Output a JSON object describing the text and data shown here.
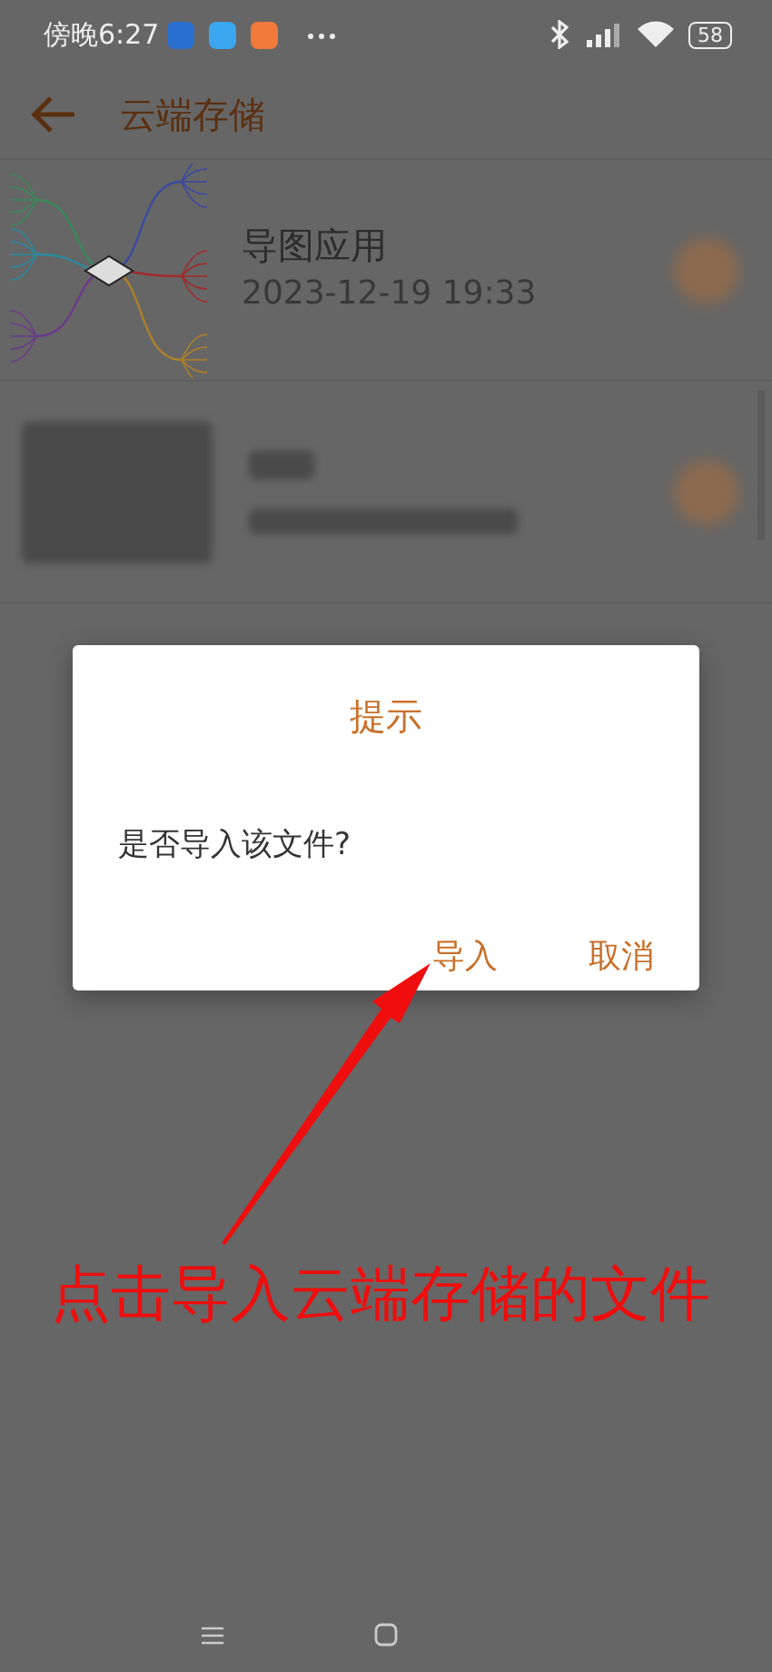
{
  "status_bar": {
    "time": "傍晚6:27",
    "battery": "58"
  },
  "header": {
    "title": "云端存储"
  },
  "files": [
    {
      "kind": "mindmap",
      "name": "导图应用",
      "date": "2023-12-19 19:33"
    },
    {
      "kind": "blurred"
    }
  ],
  "dialog": {
    "title": "提示",
    "message": "是否导入该文件?",
    "buttons": [
      "导入",
      "取消"
    ]
  },
  "annotation": {
    "text": "点击导入云端存储的文件"
  }
}
